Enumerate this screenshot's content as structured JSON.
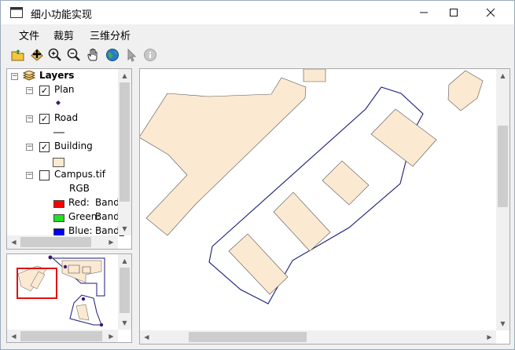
{
  "window": {
    "title": "细小功能实现",
    "controls": {
      "minimize": "—",
      "maximize": "☐",
      "close": "✕"
    }
  },
  "menu": {
    "items": [
      "文件",
      "裁剪",
      "三维分析"
    ]
  },
  "toolbar": {
    "buttons": [
      "open-folder",
      "add-data",
      "zoom-in",
      "zoom-out",
      "pan",
      "full-extent",
      "select",
      "identify"
    ]
  },
  "toc": {
    "root_label": "Layers",
    "layers": [
      {
        "name": "Plan",
        "checked": "✓"
      },
      {
        "name": "Road",
        "checked": "✓"
      },
      {
        "name": "Building",
        "checked": "✓"
      },
      {
        "name": "Campus.tif",
        "checked": ""
      }
    ],
    "rgb_label": "RGB",
    "bands": [
      {
        "label": "Red:",
        "value": "Band_",
        "color": "#ff0000"
      },
      {
        "label": "Green:",
        "value": "Band_",
        "color": "#22e022"
      },
      {
        "label": "Blue:",
        "value": "Band_",
        "color": "#0000ee"
      }
    ]
  },
  "colors": {
    "building_fill": "#fbe9d2",
    "road_line": "#1a1a7a",
    "overview_extent": "#e01010"
  }
}
